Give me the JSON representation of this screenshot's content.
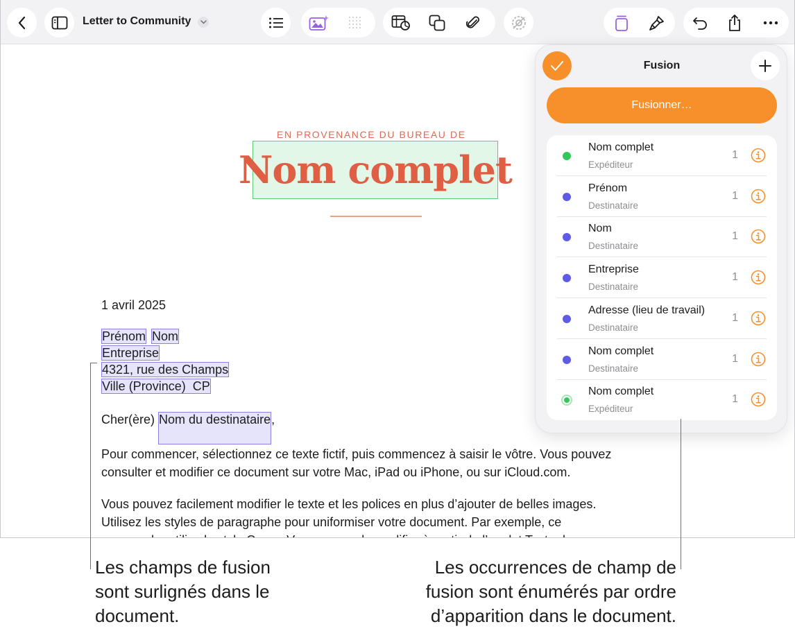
{
  "toolbar": {
    "doc_title": "Letter to Community"
  },
  "document": {
    "eyebrow": "EN PROVENANCE DU BUREAU DE",
    "sender_field": "Nom complet",
    "date": "1 avril 2025",
    "fields": {
      "prenom": "Prénom",
      "nom": "Nom",
      "entreprise": "Entreprise",
      "adresse": "4321, rue des Champs",
      "ville": "Ville (Province)  CP",
      "greeting_prefix": "Cher(ère) ",
      "destinataire": "Nom du destinataire",
      "greeting_suffix": ","
    },
    "paragraphs": [
      "Pour commencer, sélectionnez ce texte fictif, puis commencez à saisir le vôtre. Vous pouvez",
      "consulter et modifier ce document sur votre Mac, iPad ou iPhone, ou sur iCloud.com.",
      "Vous pouvez facilement modifier le texte et les polices en plus d’ajouter de belles images.",
      "Utilisez les styles de paragraphe pour uniformiser votre document. Par exemple, ce",
      "paragraphe utilise le style Corps. Vous pouvez le modifier à partir de l’onglet Texte de"
    ]
  },
  "merge_panel": {
    "title": "Fusion",
    "merge_button": "Fusionner…",
    "items": [
      {
        "name": "Nom complet",
        "role": "Expéditeur",
        "count": "1",
        "color": "#34c759",
        "style": "dot"
      },
      {
        "name": "Prénom",
        "role": "Destinataire",
        "count": "1",
        "color": "#5e5ce6",
        "style": "dot"
      },
      {
        "name": "Nom",
        "role": "Destinataire",
        "count": "1",
        "color": "#5e5ce6",
        "style": "dot"
      },
      {
        "name": "Entreprise",
        "role": "Destinataire",
        "count": "1",
        "color": "#5e5ce6",
        "style": "dot"
      },
      {
        "name": "Adresse (lieu de travail)",
        "role": "Destinataire",
        "count": "1",
        "color": "#5e5ce6",
        "style": "dot"
      },
      {
        "name": "Nom complet",
        "role": "Destinataire",
        "count": "1",
        "color": "#5e5ce6",
        "style": "dot"
      },
      {
        "name": "Nom complet",
        "role": "Expéditeur",
        "count": "1",
        "color": "#34c759",
        "style": "ring"
      }
    ]
  },
  "callouts": {
    "left": [
      "Les champs de fusion",
      "sont surlignés dans le",
      "document."
    ],
    "right": [
      "Les occurrences de champ de",
      "fusion sont énumérés par ordre",
      "d’apparition dans le document."
    ]
  },
  "colors": {
    "accent_orange": "#f7902b",
    "sender_green": "#34c759",
    "recipient_purple": "#5e5ce6",
    "title_coral": "#df5f45"
  }
}
